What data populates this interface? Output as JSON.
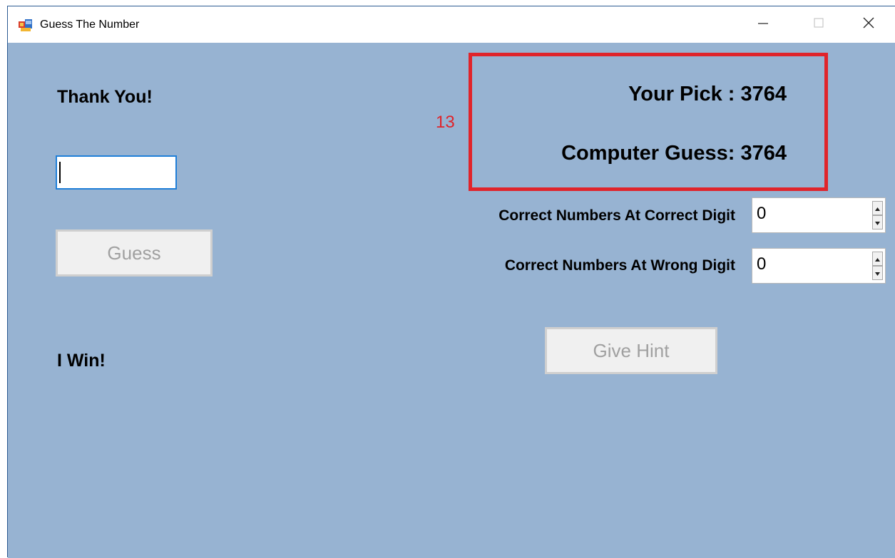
{
  "window": {
    "title": "Guess The Number",
    "icon": "winforms-app-icon"
  },
  "left": {
    "message": "Thank You!",
    "input_value": "",
    "guess_button": "Guess",
    "result": "I Win!"
  },
  "annotation": {
    "counter": "13",
    "color": "#e0242b"
  },
  "right": {
    "your_pick": "Your Pick : 3764",
    "computer_guess": "Computer Guess: 3764",
    "correct_digit_label": "Correct Numbers At Correct Digit",
    "correct_digit_value": "0",
    "wrong_digit_label": "Correct Numbers At Wrong Digit",
    "wrong_digit_value": "0",
    "hint_button": "Give Hint"
  },
  "colors": {
    "client_background": "#97b3d2",
    "input_focus_border": "#1f7fd8",
    "disabled_text": "#a0a0a0"
  }
}
